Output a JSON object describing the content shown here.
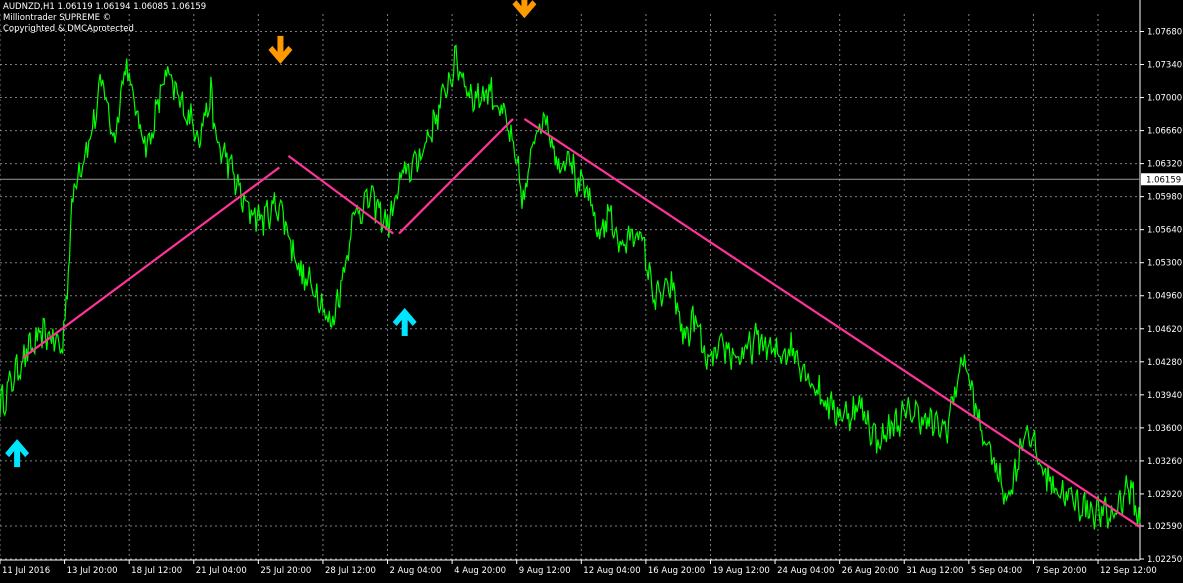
{
  "header": {
    "symbol_line": "AUDNZD,H1  1.06119 1.06194 1.06085 1.06159",
    "indicator_name": "Milliontrader SUPREME ©",
    "copyright": "Copyrighted & DMCAprotected"
  },
  "colors": {
    "background": "#000000",
    "grid": "#b4b4b4",
    "price_line": "#00ff00",
    "trend_lines": "#ff3399",
    "buy_arrow": "#00e5ff",
    "sell_arrow": "#ff9900",
    "axis_text": "#ffffff",
    "current_price_box": "#ffffff"
  },
  "chart_data": {
    "type": "line",
    "symbol": "AUDNZD",
    "timeframe": "H1",
    "current_price": "1.06159",
    "ylim": [
      1.0224,
      1.0786
    ],
    "y_ticks": [
      "1.07680",
      "1.07340",
      "1.07000",
      "1.06660",
      "1.06320",
      "1.05980",
      "1.05640",
      "1.05300",
      "1.04960",
      "1.04620",
      "1.04280",
      "1.03940",
      "1.03600",
      "1.03260",
      "1.02920",
      "1.02590",
      "1.02250"
    ],
    "x_ticks": [
      "11 Jul 2016",
      "13 Jul 20:00",
      "18 Jul 12:00",
      "21 Jul 04:00",
      "25 Jul 20:00",
      "28 Jul 12:00",
      "2 Aug 04:00",
      "4 Aug 20:00",
      "9 Aug 12:00",
      "12 Aug 04:00",
      "16 Aug 20:00",
      "19 Aug 12:00",
      "24 Aug 04:00",
      "26 Aug 20:00",
      "31 Aug 12:00",
      "5 Sep 04:00",
      "7 Sep 20:00",
      "12 Sep 12:00"
    ],
    "grid": true,
    "price_series": {
      "x": [
        0,
        0.02,
        0.04,
        0.055,
        0.065,
        0.08,
        0.09,
        0.1,
        0.11,
        0.12,
        0.13,
        0.145,
        0.16,
        0.175,
        0.185,
        0.19,
        0.2,
        0.215,
        0.23,
        0.245,
        0.255,
        0.265,
        0.28,
        0.29,
        0.3,
        0.31,
        0.325,
        0.34,
        0.355,
        0.365,
        0.375,
        0.385,
        0.4,
        0.415,
        0.43,
        0.445,
        0.46,
        0.47,
        0.48,
        0.49,
        0.5,
        0.505,
        0.515,
        0.525,
        0.535,
        0.545,
        0.56,
        0.575,
        0.59,
        0.6,
        0.61,
        0.62,
        0.635,
        0.65,
        0.665,
        0.68,
        0.695,
        0.71,
        0.725,
        0.74,
        0.755,
        0.77,
        0.785,
        0.8,
        0.815,
        0.83,
        0.845,
        0.86,
        0.87,
        0.875,
        0.885,
        0.9,
        0.915,
        0.93,
        0.945,
        0.96,
        0.975,
        0.99,
        1.0
      ],
      "y": [
        1.0382,
        1.0432,
        1.0458,
        1.0442,
        1.0612,
        1.0662,
        1.0718,
        1.0655,
        1.0736,
        1.0682,
        1.0648,
        1.0725,
        1.0692,
        1.0662,
        1.0702,
        1.0652,
        1.0635,
        1.0588,
        1.0575,
        1.0592,
        1.0552,
        1.0515,
        1.0498,
        1.0462,
        1.0512,
        1.0578,
        1.0598,
        1.0568,
        1.0625,
        1.0632,
        1.0658,
        1.0688,
        1.0738,
        1.0698,
        1.0708,
        1.0672,
        1.0592,
        1.0672,
        1.0678,
        1.0628,
        1.0648,
        1.0612,
        1.0602,
        1.0558,
        1.0582,
        1.0545,
        1.0565,
        1.0492,
        1.0505,
        1.0452,
        1.0472,
        1.0425,
        1.0442,
        1.0432,
        1.0452,
        1.0435,
        1.0442,
        1.0412,
        1.0385,
        1.0372,
        1.0382,
        1.0345,
        1.0365,
        1.0378,
        1.0365,
        1.0358,
        1.0435,
        1.0358,
        1.0332,
        1.0312,
        1.0288,
        1.0362,
        1.0315,
        1.0295,
        1.0282,
        1.0275,
        1.0268,
        1.0302,
        1.0262
      ]
    },
    "trend_lines": [
      {
        "x": [
          0.02,
          0.245
        ],
        "y": [
          1.0432,
          1.0628
        ]
      },
      {
        "x": [
          0.253,
          0.345
        ],
        "y": [
          1.064,
          1.056
        ]
      },
      {
        "x": [
          0.35,
          0.45
        ],
        "y": [
          1.056,
          1.0678
        ]
      },
      {
        "x": [
          0.46,
          1.0
        ],
        "y": [
          1.0678,
          1.0258
        ]
      }
    ],
    "signals": [
      {
        "type": "buy",
        "x": 0.015,
        "y": 1.0335
      },
      {
        "type": "sell",
        "x": 0.246,
        "y": 1.0748
      },
      {
        "type": "buy",
        "x": 0.355,
        "y": 1.047
      },
      {
        "type": "sell",
        "x": 0.46,
        "y": 1.0795
      }
    ]
  }
}
